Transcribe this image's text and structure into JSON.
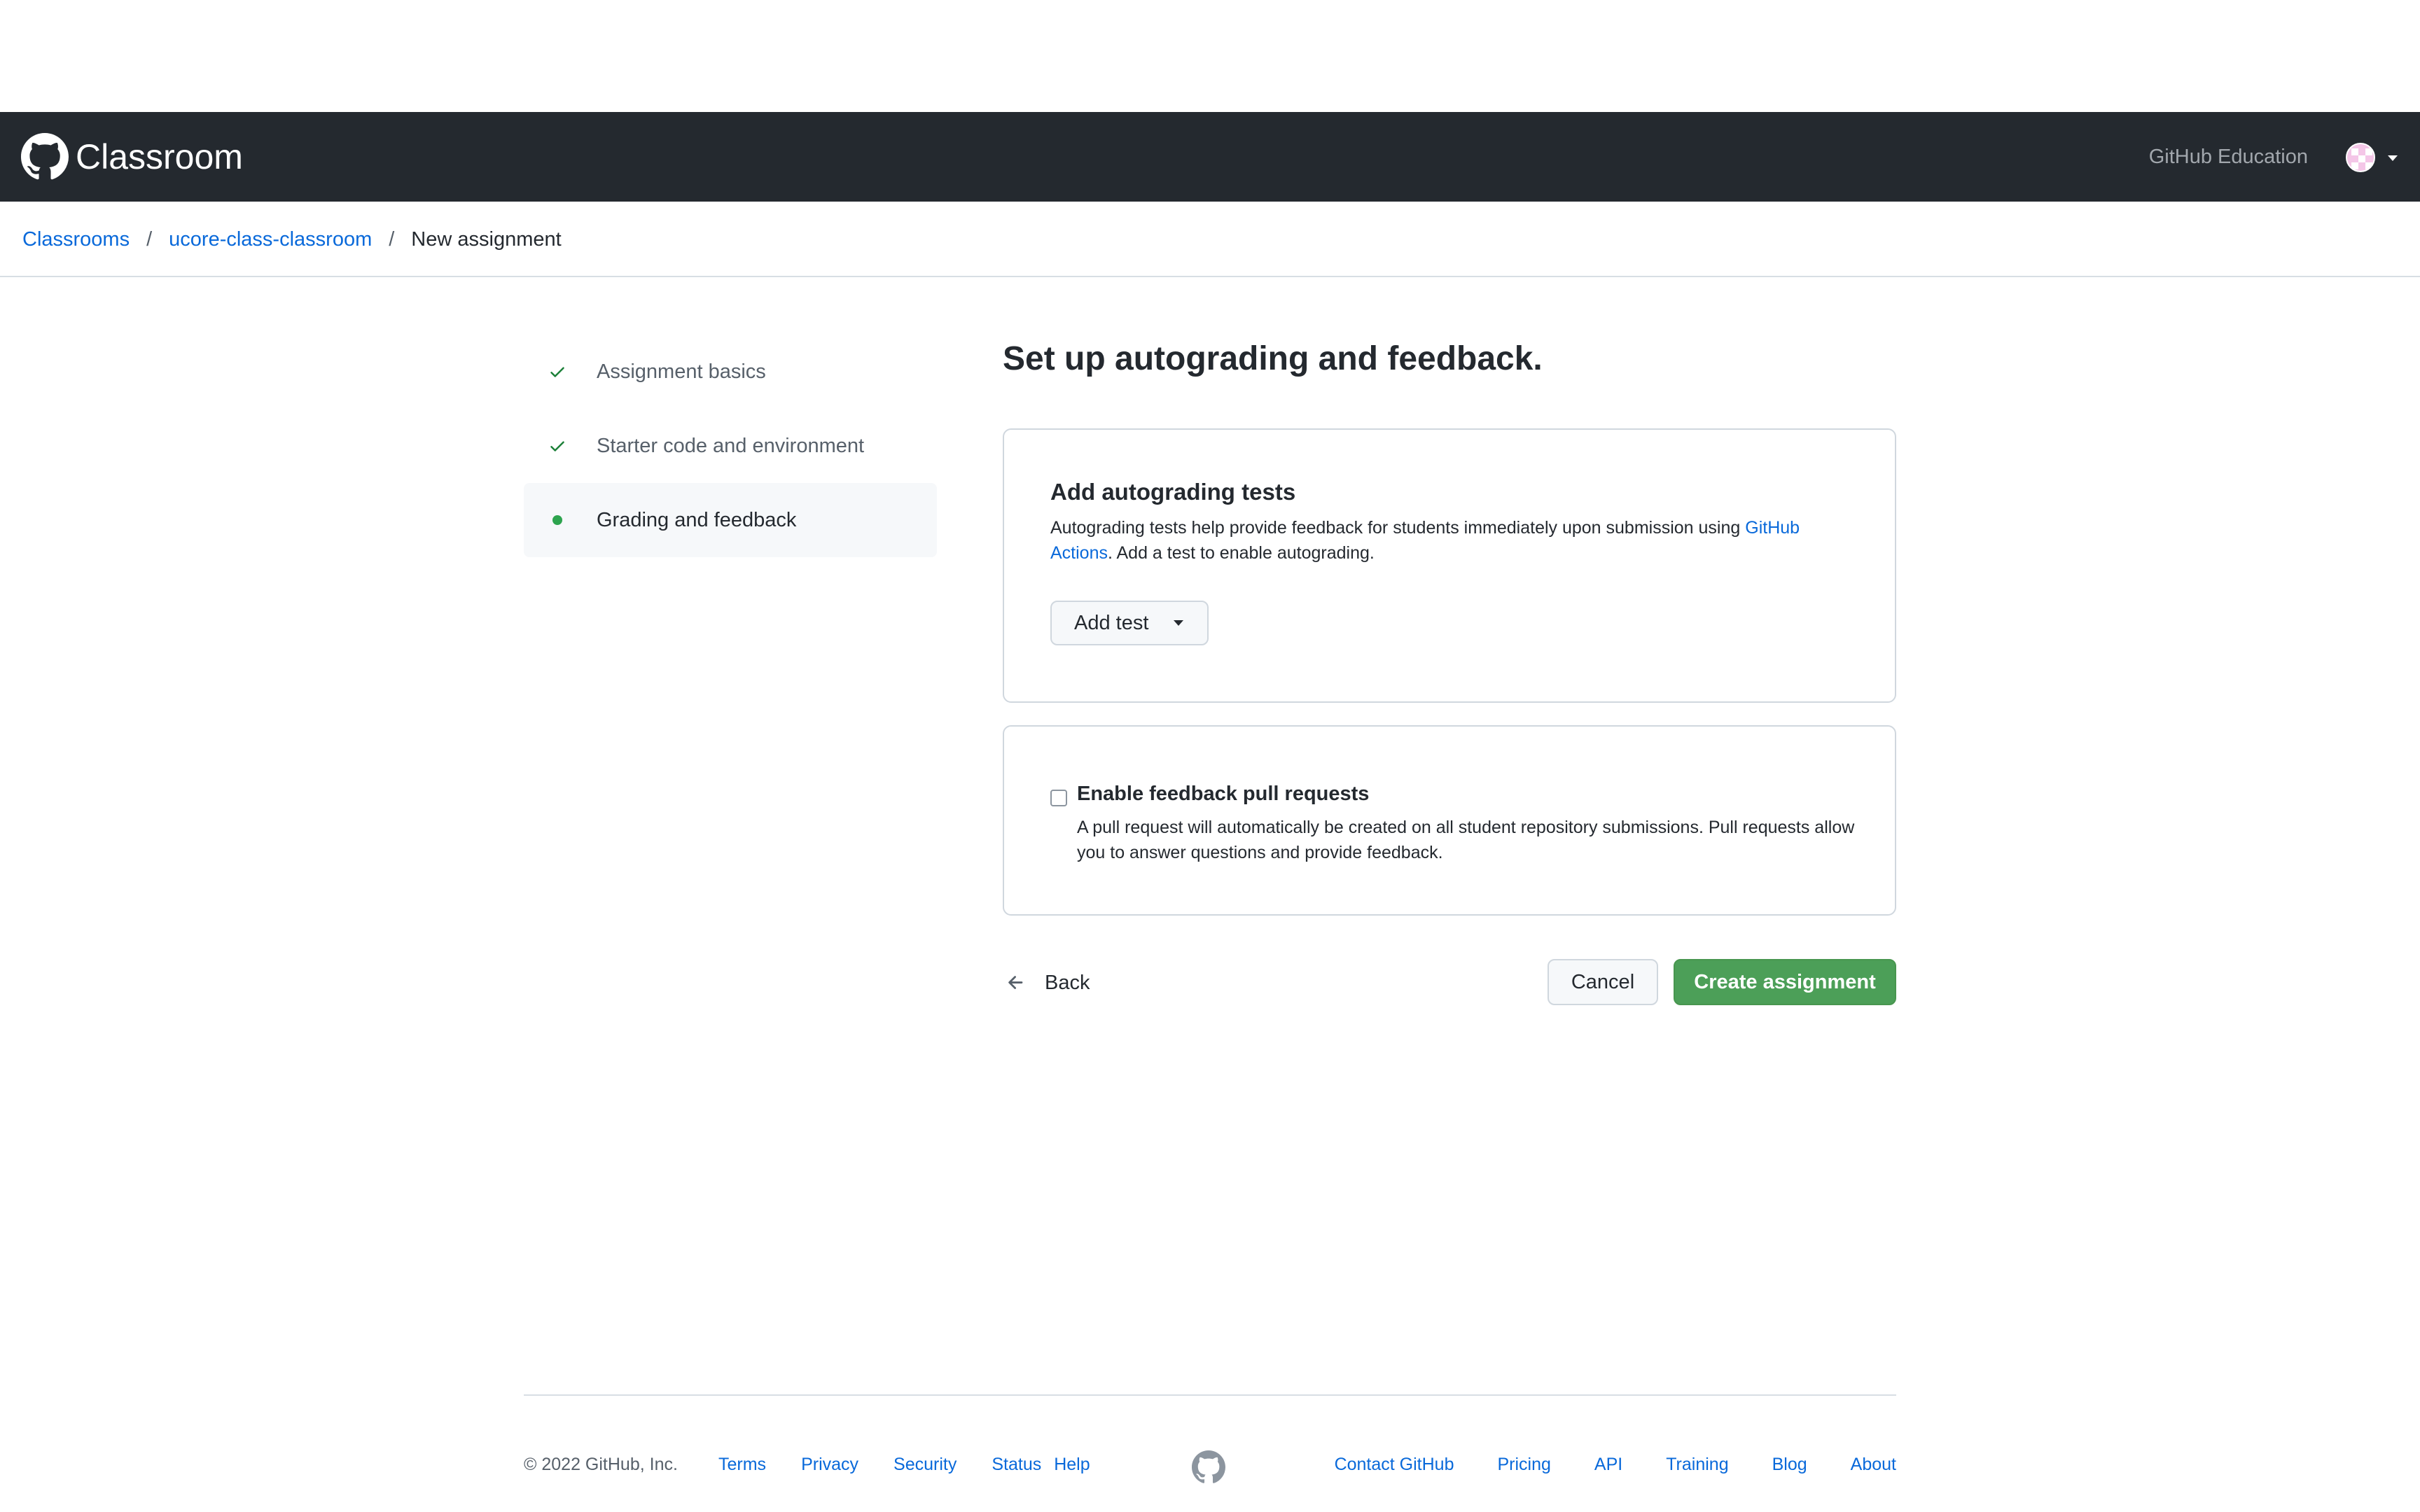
{
  "header": {
    "brand": "Classroom",
    "github_education": "GitHub Education",
    "colors": {
      "background": "#24292f",
      "text": "#ffffff"
    }
  },
  "breadcrumb": {
    "items": [
      "Classrooms",
      "ucore-class-classroom"
    ],
    "current": "New assignment",
    "separator": "/"
  },
  "steps": [
    {
      "label": "Assignment basics",
      "state": "complete",
      "icon": "check-icon"
    },
    {
      "label": "Starter code and environment",
      "state": "complete",
      "icon": "check-icon"
    },
    {
      "label": "Grading and feedback",
      "state": "current",
      "icon": "dot-icon"
    }
  ],
  "main": {
    "title": "Set up autograding and feedback.",
    "autograding": {
      "heading": "Add autograding tests",
      "desc_before": "Autograding tests help provide feedback for students immediately upon submission using ",
      "desc_link": "GitHub Actions",
      "desc_after": ". Add a test to enable autograding.",
      "add_test_label": "Add test"
    },
    "feedback": {
      "checkbox_label": "Enable feedback pull requests",
      "checked": false,
      "desc": "A pull request will automatically be created on all student repository submissions. Pull requests allow you to answer questions and provide feedback."
    }
  },
  "actions": {
    "back_label": "Back",
    "cancel_label": "Cancel",
    "create_label": "Create assignment",
    "create_color": "#4c9f58"
  },
  "footer": {
    "copyright": "© 2022 GitHub, Inc.",
    "left_links": [
      "Terms",
      "Privacy",
      "Security",
      "Status",
      "Help"
    ],
    "right_links": [
      "Contact GitHub",
      "Pricing",
      "API",
      "Training",
      "Blog",
      "About"
    ]
  }
}
